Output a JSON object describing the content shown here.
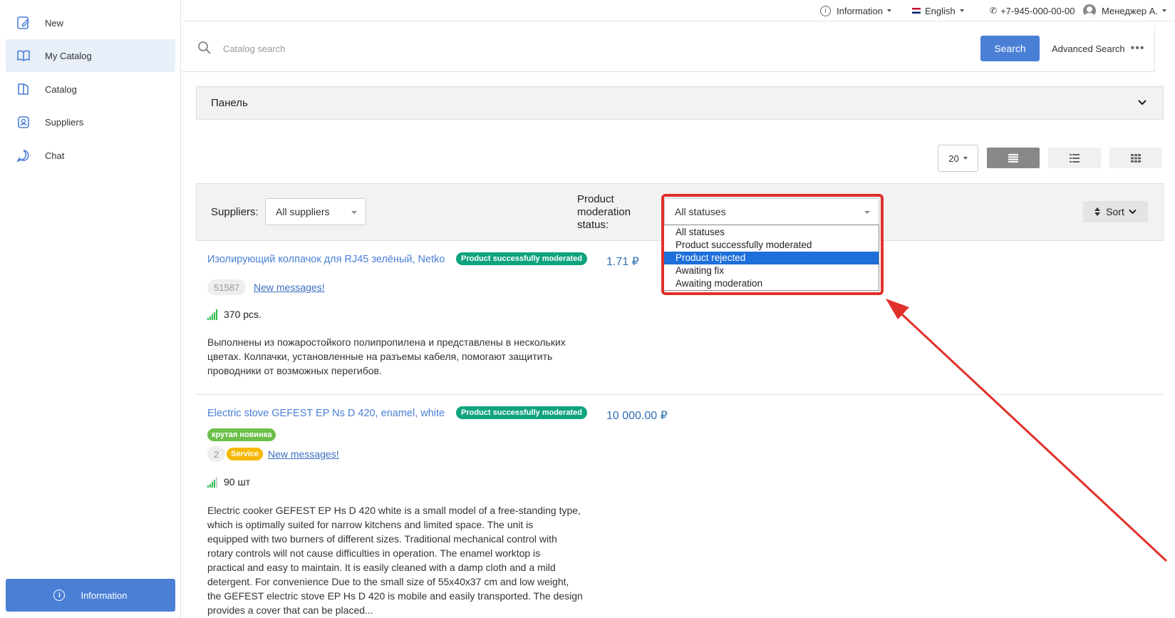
{
  "sidebar": {
    "items": [
      {
        "label": "New",
        "icon": "new-icon"
      },
      {
        "label": "My Catalog",
        "icon": "book-icon",
        "active": true
      },
      {
        "label": "Catalog",
        "icon": "catalog-icon"
      },
      {
        "label": "Suppliers",
        "icon": "suppliers-icon"
      },
      {
        "label": "Chat",
        "icon": "chat-icon"
      }
    ],
    "info_button": "Information"
  },
  "topbar": {
    "information": "Information",
    "language": "English",
    "phone": "+7-945-000-00-00",
    "user": "Менеджер А."
  },
  "search": {
    "placeholder": "Catalog search",
    "button": "Search",
    "advanced": "Advanced Search",
    "more": "•••"
  },
  "panel": {
    "title": "Панель"
  },
  "view": {
    "per_page": "20"
  },
  "filters": {
    "suppliers_label": "Suppliers:",
    "suppliers_value": "All suppliers",
    "status_label_1": "Product",
    "status_label_2": "moderation",
    "status_label_3": "status:",
    "status_value": "All statuses",
    "status_options": [
      "All statuses",
      "Product successfully moderated",
      "Product rejected",
      "Awaiting fix",
      "Awaiting moderation"
    ],
    "status_selected_index": 2,
    "sort": "Sort"
  },
  "products": [
    {
      "title": "Изолирующий колпачок для RJ45 зелёный, Netko",
      "status": "Product successfully moderated",
      "price": "1.71 ₽",
      "id": "51587",
      "messages": "New messages!",
      "stock": "370 pcs.",
      "desc_1": "Выполнены из пожаростойкого полипропилена и представлены в нескольких",
      "desc_2": "цветах. Колпачки, установленные на разъемы кабеля, помогают защитить",
      "desc_3": "проводники от возможных перегибов."
    },
    {
      "title": "Electric stove GEFEST EP Ns D 420, enamel, white",
      "status": "Product successfully moderated",
      "price": "10 000.00 ₽",
      "tag": "крутая новинка",
      "id": "2",
      "service": "Service",
      "messages": "New messages!",
      "stock": "90 шт",
      "desc_1": "Electric cooker GEFEST EP Hs D 420 white is a small model of a free-standing type,",
      "desc_2": "which is optimally suited for narrow kitchens and limited space. The unit is",
      "desc_3": "equipped with two burners of different sizes. Traditional mechanical control with",
      "desc_4": "rotary controls will not cause difficulties in operation. The enamel worktop is",
      "desc_5": "practical and easy to maintain. It is easily cleaned with a damp cloth and a mild",
      "desc_6": "detergent. For convenience Due to the small size of 55x40x37 cm and low weight,",
      "desc_7": "the GEFEST electric stove EP Hs D 420 is mobile and easily transported. The design",
      "desc_8": "provides a cover that can be placed..."
    }
  ],
  "colors": {
    "accent": "#4a7fd6",
    "moderated": "#0fa37f",
    "highlight": "#e0302a",
    "selected_option": "#1e6fd9"
  }
}
